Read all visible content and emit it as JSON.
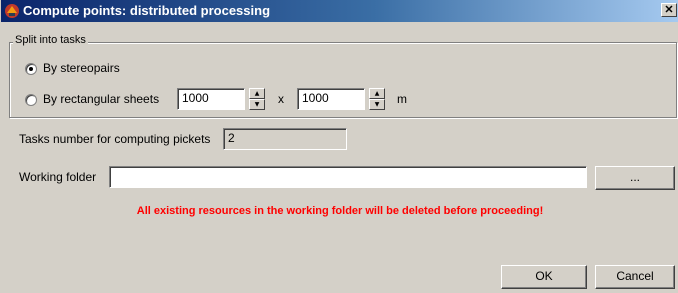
{
  "window": {
    "title": "Compute points: distributed processing",
    "close_glyph": "✕"
  },
  "split": {
    "legend": "Split into tasks",
    "by_stereopairs_label": "By stereopairs",
    "by_sheets_label": "By rectangular sheets",
    "selected": "By stereopairs",
    "sheet_width": "1000",
    "sheet_height": "1000",
    "times": "x",
    "unit": "m"
  },
  "tasks": {
    "label": "Tasks number for computing pickets",
    "value": "2"
  },
  "folder": {
    "label": "Working folder",
    "value": "",
    "browse_label": "..."
  },
  "warning": "All existing resources in the working folder will be deleted before proceeding!",
  "buttons": {
    "ok": "OK",
    "cancel": "Cancel"
  },
  "colors": {
    "warning": "#ff0000",
    "titlebar_start": "#0a246a",
    "titlebar_end": "#a6caf0",
    "dialog_bg": "#d4d0c8"
  },
  "icons": {
    "app": "app-logo-icon",
    "close": "close-icon",
    "spin_up": "spin-up-icon",
    "spin_down": "spin-down-icon"
  }
}
